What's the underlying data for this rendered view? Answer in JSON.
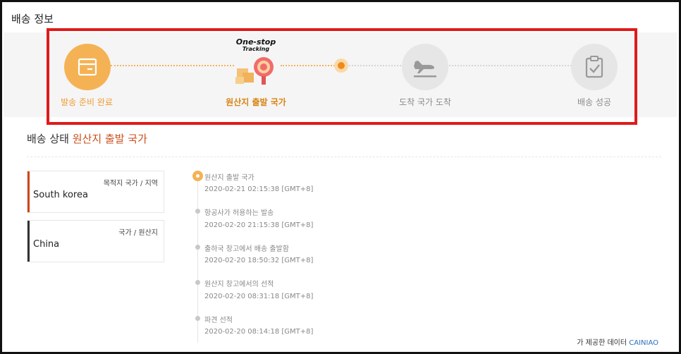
{
  "page": {
    "title": "배송 정보"
  },
  "progress": {
    "badge_line1": "One-stop",
    "badge_line2": "Tracking",
    "steps": [
      {
        "label": "발송 준비 완료",
        "state": "done",
        "icon": "package-box-icon"
      },
      {
        "label": "원산지 출발 국가",
        "state": "active",
        "icon": "one-stop-tracking-icon"
      },
      {
        "label": "도착 국가 도착",
        "state": "todo",
        "icon": "airplane-landing-icon"
      },
      {
        "label": "배송 성공",
        "state": "todo",
        "icon": "clipboard-check-icon"
      }
    ]
  },
  "status": {
    "label": "배송 상태",
    "value": "원산지 출발 국가"
  },
  "locations": [
    {
      "caption": "목적지 국가 / 지역",
      "name": "South korea",
      "color": "#d2441c"
    },
    {
      "caption": "국가 / 원산지",
      "name": "China",
      "color": "#333333"
    }
  ],
  "timeline": [
    {
      "title": "원산지 출발 국가",
      "time": "2020-02-21 02:15:38 [GMT+8]"
    },
    {
      "title": "항공사가 허용하는 발송",
      "time": "2020-02-20 21:15:38 [GMT+8]"
    },
    {
      "title": "출하국 창고에서 배송 출발함",
      "time": "2020-02-20 18:50:32 [GMT+8]"
    },
    {
      "title": "원산지 창고에서의 선적",
      "time": "2020-02-20 08:31:18 [GMT+8]"
    },
    {
      "title": "파견 선적",
      "time": "2020-02-20 08:14:18 [GMT+8]"
    }
  ],
  "credit": {
    "text": "가 제공한 데이터",
    "brand": "CAINIAO"
  },
  "colors": {
    "accent": "#f5b254",
    "highlight_border": "#e01a1a",
    "status_value": "#c9501c"
  }
}
